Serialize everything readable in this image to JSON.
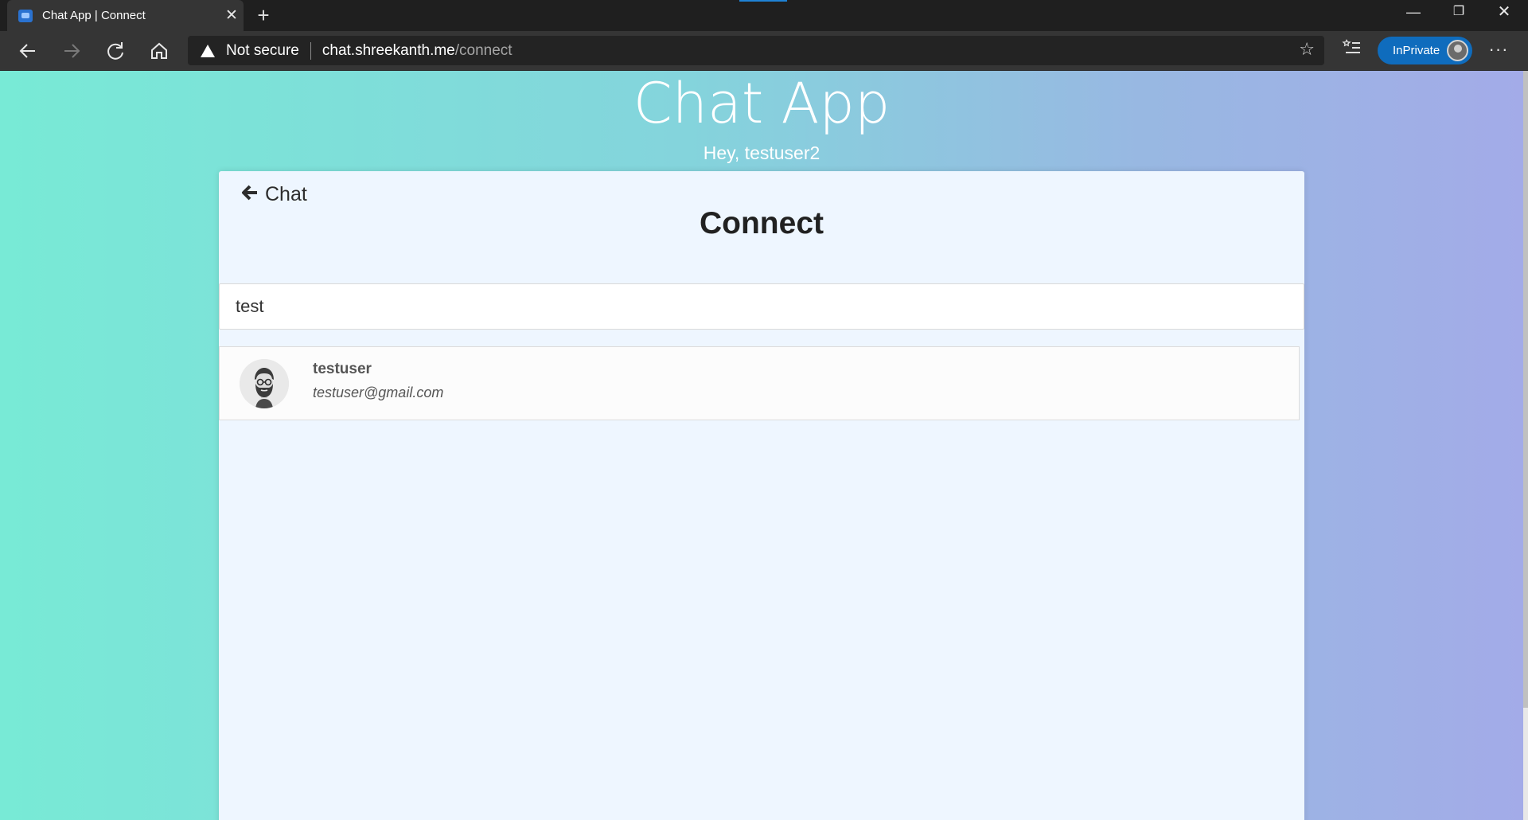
{
  "browser": {
    "tab_title": "Chat App | Connect",
    "tab_close": "✕",
    "new_tab": "+",
    "security_label": "Not secure",
    "url_host": "chat.shreekanth.me",
    "url_path": "/connect",
    "inprivate_label": "InPrivate",
    "window_controls": {
      "minimize": "—",
      "restore": "❐",
      "close": "✕"
    }
  },
  "app": {
    "title": "Chat App",
    "greeting": "Hey, testuser2"
  },
  "connect": {
    "back_label": "Chat",
    "heading": "Connect",
    "search_value": "test",
    "results": [
      {
        "name": "testuser",
        "email": "testuser@gmail.com",
        "avatar_icon": "bearded-man-avatar"
      }
    ]
  },
  "colors": {
    "gradient_start": "#78ead6",
    "gradient_end": "#a3abe8",
    "card_bg": "#eef6ff",
    "inprivate_badge": "#0f6cbd"
  }
}
